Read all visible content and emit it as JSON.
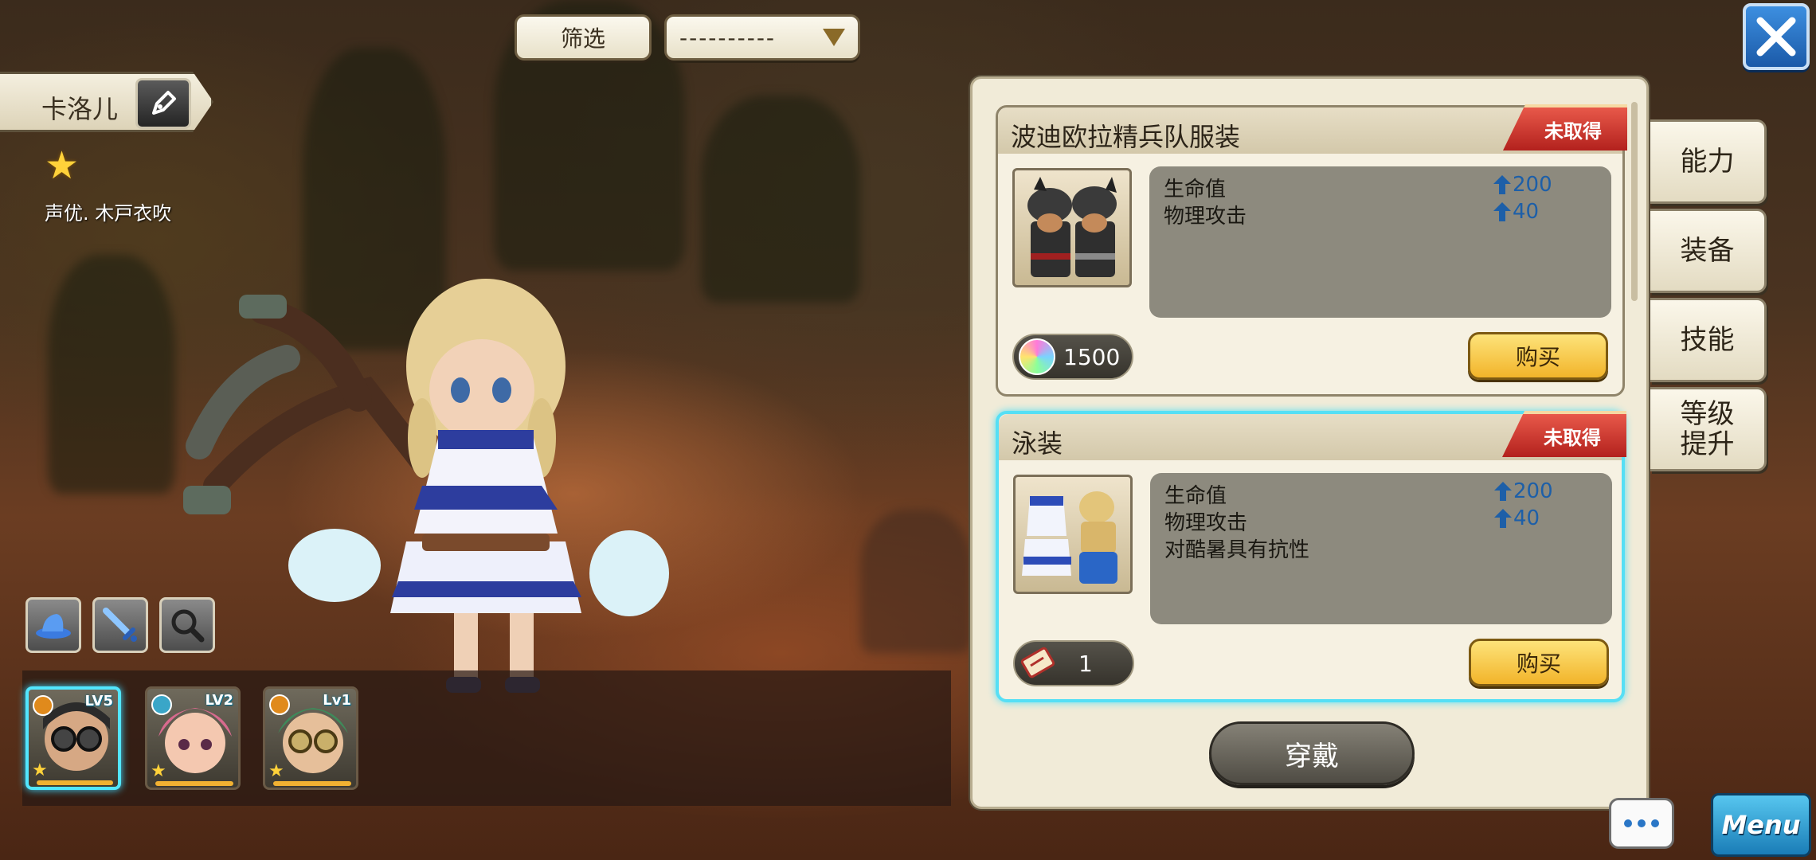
{
  "filter": {
    "label": "筛选",
    "dropdown_value": "----------"
  },
  "character": {
    "name": "卡洛儿",
    "stars": "★",
    "voice": "声优. 木戸衣吹"
  },
  "party": [
    {
      "level": "LV5",
      "star": "★",
      "active": true
    },
    {
      "level": "LV2",
      "star": "★",
      "active": false
    },
    {
      "level": "Lv1",
      "star": "★",
      "active": false
    }
  ],
  "tools": [
    "hat-icon",
    "sword-icon",
    "magnifier-icon"
  ],
  "costumes": [
    {
      "title": "波迪欧拉精兵队服装",
      "status": "未取得",
      "stats": [
        {
          "name": "生命值",
          "value": "200"
        },
        {
          "name": "物理攻击",
          "value": "40"
        }
      ],
      "extra": "",
      "cost": "1500",
      "cost_icon": "rainbow-gem-icon",
      "buy_label": "购买"
    },
    {
      "title": "泳装",
      "status": "未取得",
      "stats": [
        {
          "name": "生命值",
          "value": "200"
        },
        {
          "name": "物理攻击",
          "value": "40"
        }
      ],
      "extra": "对酷暑具有抗性",
      "cost": "1",
      "cost_icon": "ticket-icon",
      "buy_label": "购买"
    }
  ],
  "wear_label": "穿戴",
  "side_tabs": [
    "能力",
    "装备",
    "技能",
    "等级\n提升"
  ],
  "menu_label": "Menu",
  "colors": {
    "accent_blue": "#1d5fa8",
    "selected_border": "#56dff5",
    "buy_yellow": "#f2b42a",
    "ribbon_red": "#b3211d"
  }
}
